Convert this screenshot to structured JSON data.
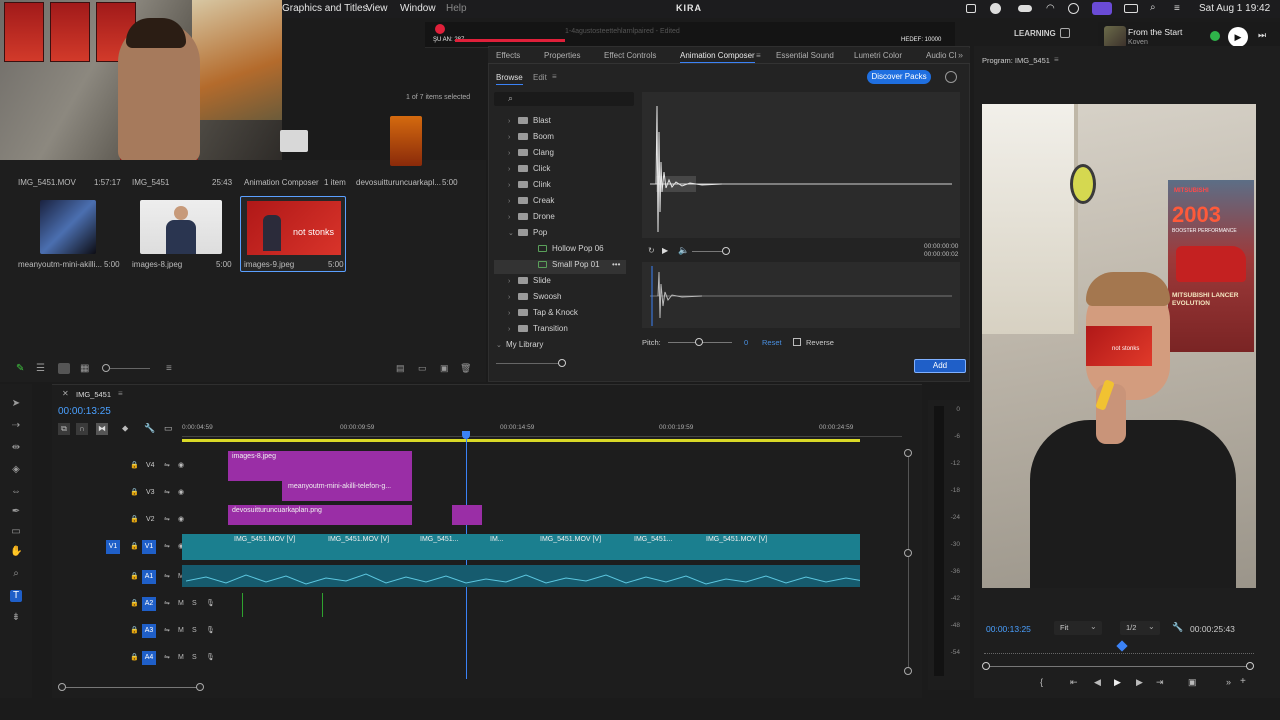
{
  "menubar": {
    "items": [
      "Graphics and Titles",
      "View",
      "Window",
      "Help"
    ],
    "center_app": "KIRA",
    "clock": "Sat Aug 1  19:42",
    "learning": "LEARNING",
    "now_playing": {
      "title": "From the Start",
      "artist": "Koven"
    }
  },
  "overlay": {
    "left": "ŞU AN: 287",
    "right": "HEDEF: 10000",
    "doc_title": "1-4agustosteettehlarnlpaired - Edited"
  },
  "bin": {
    "selection": "1 of 7 items selected",
    "row1": [
      {
        "name": "IMG_5451.MOV",
        "dur": "1:57:17"
      },
      {
        "name": "IMG_5451",
        "dur": "25:43"
      },
      {
        "name": "Animation Composer",
        "dur": "1 item"
      },
      {
        "name": "devosuitturuncuarkapl...",
        "dur": "5:00"
      }
    ],
    "row2": [
      {
        "name": "meanyoutm-mini-akilli...",
        "dur": "5:00"
      },
      {
        "name": "images-8.jpeg",
        "dur": "5:00"
      },
      {
        "name": "images-9.jpeg",
        "dur": "5:00",
        "overlay": "not stonks"
      }
    ]
  },
  "panel": {
    "tabs": [
      "Effects",
      "Properties",
      "Effect Controls",
      "Animation Composer",
      "Essential Sound",
      "Lumetri Color",
      "Audio Cl"
    ],
    "active_tab": "Animation Composer",
    "subtabs": [
      "Browse",
      "Edit"
    ],
    "discover": "Discover Packs",
    "tree": [
      {
        "label": "Blast",
        "type": "folder"
      },
      {
        "label": "Boom",
        "type": "folder"
      },
      {
        "label": "Clang",
        "type": "folder"
      },
      {
        "label": "Click",
        "type": "folder"
      },
      {
        "label": "Clink",
        "type": "folder"
      },
      {
        "label": "Creak",
        "type": "folder"
      },
      {
        "label": "Drone",
        "type": "folder"
      },
      {
        "label": "Pop",
        "type": "folder-open"
      },
      {
        "label": "Hollow Pop 06",
        "type": "item"
      },
      {
        "label": "Small Pop 01",
        "type": "item-selected"
      },
      {
        "label": "Slide",
        "type": "folder"
      },
      {
        "label": "Swoosh",
        "type": "folder"
      },
      {
        "label": "Tap & Knock",
        "type": "folder"
      },
      {
        "label": "Transition",
        "type": "folder"
      },
      {
        "label": "My Library",
        "type": "library"
      }
    ],
    "time1": "00:00:00:00",
    "time2": "00:00:00:02",
    "pitch_label": "Pitch:",
    "pitch_value": "0",
    "reset": "Reset",
    "reverse": "Reverse",
    "add": "Add"
  },
  "program": {
    "title": "Program: IMG_5451",
    "poster_text": "2003",
    "poster_sub": "BOOSTER PERFORMANCE",
    "poster_bottom": "MITSUBISHI LANCER EVOLUTION",
    "sticker": "not stonks",
    "timecode": "00:00:13:25",
    "fit": "Fit",
    "res": "1/2",
    "duration": "00:00:25:43"
  },
  "timeline": {
    "sequence": "IMG_5451",
    "timecode": "00:00:13:25",
    "ruler": [
      "0:00:04:59",
      "00:00:09:59",
      "00:00:14:59",
      "00:00:19:59",
      "00:00:24:59"
    ],
    "tracks": [
      "V4",
      "V3",
      "V2",
      "V1",
      "A1",
      "A2",
      "A3",
      "A4"
    ],
    "clips_v4": "images-8.jpeg",
    "clips_v3": "meanyoutm-mini-akilli-telefon-g...",
    "clips_v2": "devosuitturuncuarkaplan.png",
    "clips_v1": [
      "IMG_5451.MOV [V]",
      "IMG_5451.MOV [V]",
      "IMG_5451...",
      "IM...",
      "IMG_5451.MOV [V]",
      "IMG_5451...",
      "IMG_5451.MOV [V]"
    ],
    "db_scale": [
      "0",
      "-6",
      "-12",
      "-18",
      "-24",
      "-30",
      "-36",
      "-42",
      "-48",
      "-54"
    ]
  }
}
